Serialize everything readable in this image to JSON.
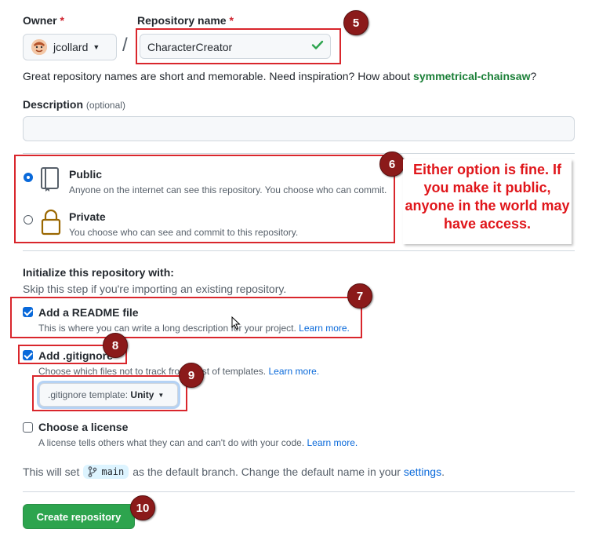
{
  "owner": {
    "label": "Owner",
    "required_mark": "*",
    "value": "jcollard"
  },
  "separator": "/",
  "repo": {
    "label": "Repository name",
    "required_mark": "*",
    "value": "CharacterCreator"
  },
  "name_hint": {
    "text": "Great repository names are short and memorable. Need inspiration? How about ",
    "suggestion": "symmetrical-chainsaw",
    "end": "?"
  },
  "description": {
    "label": "Description",
    "optional": "(optional)",
    "value": ""
  },
  "visibility": {
    "public": {
      "title": "Public",
      "desc": "Anyone on the internet can see this repository. You choose who can commit.",
      "selected": true
    },
    "private": {
      "title": "Private",
      "desc": "You choose who can see and commit to this repository.",
      "selected": false
    }
  },
  "callout": "Either option is fine. If you make it public, anyone in the world may have access.",
  "init": {
    "heading": "Initialize this repository with:",
    "skip": "Skip this step if you're importing an existing repository.",
    "readme": {
      "title": "Add a README file",
      "desc": "This is where you can write a long description for your project.",
      "link": "Learn more.",
      "checked": true
    },
    "gitignore": {
      "title": "Add .gitignore",
      "desc": "Choose which files not to track from a list of templates.",
      "link": "Learn more.",
      "checked": true
    },
    "template": {
      "label": ".gitignore template:",
      "value": "Unity"
    },
    "license": {
      "title": "Choose a license",
      "desc": "A license tells others what they can and can't do with your code.",
      "link": "Learn more.",
      "checked": false
    }
  },
  "branch": {
    "pre": "This will set",
    "name": "main",
    "post": "as the default branch. Change the default name in your",
    "link": "settings",
    "end": "."
  },
  "create_button": "Create repository",
  "steps": [
    "5",
    "6",
    "7",
    "8",
    "9",
    "10"
  ],
  "colors": {
    "accent": "#0969da",
    "primary_button": "#2da44e",
    "annotation": "#d9262c",
    "callout_text": "#e0161b"
  }
}
